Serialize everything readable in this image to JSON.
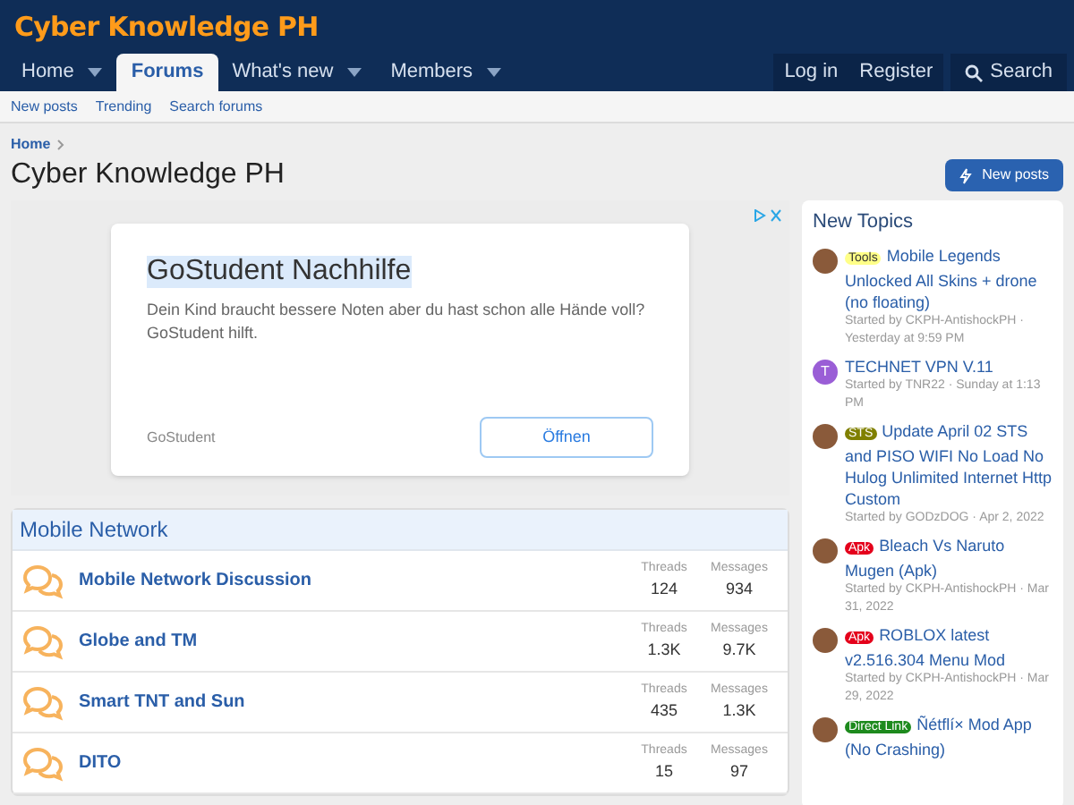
{
  "site": {
    "logo": "Cyber Knowledge PH"
  },
  "nav": {
    "tabs": [
      {
        "label": "Home",
        "selected": false,
        "has_menu": true
      },
      {
        "label": "Forums",
        "selected": true,
        "has_menu": false
      },
      {
        "label": "What's new",
        "selected": false,
        "has_menu": true
      },
      {
        "label": "Members",
        "selected": false,
        "has_menu": true
      }
    ],
    "account": [
      "Log in",
      "Register"
    ],
    "search": "Search"
  },
  "subnav": [
    "New posts",
    "Trending",
    "Search forums"
  ],
  "breadcrumb": [
    "Home"
  ],
  "page_title": "Cyber Knowledge PH",
  "new_posts_button": "New posts",
  "ad": {
    "title": "GoStudent Nachhilfe",
    "text": "Dein Kind braucht bessere Noten aber du hast schon alle Hände voll? GoStudent hilft.",
    "advertiser": "GoStudent",
    "button": "Öffnen"
  },
  "category": {
    "title": "Mobile Network",
    "forums": [
      {
        "name": "Mobile Network Discussion",
        "threads_label": "Threads",
        "threads": "124",
        "messages_label": "Messages",
        "messages": "934"
      },
      {
        "name": "Globe and TM",
        "threads_label": "Threads",
        "threads": "1.3K",
        "messages_label": "Messages",
        "messages": "9.7K"
      },
      {
        "name": "Smart TNT and Sun",
        "threads_label": "Threads",
        "threads": "435",
        "messages_label": "Messages",
        "messages": "1.3K"
      },
      {
        "name": "DITO",
        "threads_label": "Threads",
        "threads": "15",
        "messages_label": "Messages",
        "messages": "97"
      }
    ]
  },
  "sidebar": {
    "title": "New Topics",
    "topics": [
      {
        "avatar": {
          "kind": "photo"
        },
        "tag": {
          "label": "Tools",
          "color": "#ffff88"
        },
        "title": "Mobile Legends Unlocked All Skins + drone (no floating)",
        "meta": "Started by CKPH-AntishockPH · Yesterday at 9:59 PM"
      },
      {
        "avatar": {
          "kind": "letter",
          "letter": "T",
          "color": "#9a5ed6"
        },
        "title": "TECHNET VPN V.11",
        "meta": "Started by TNR22 · Sunday at 1:13 PM"
      },
      {
        "avatar": {
          "kind": "photo"
        },
        "tag": {
          "label": "STS",
          "color": "#808000"
        },
        "title": "Update April 02 STS and PISO WIFI No Load No Hulog Unlimited Internet Http Custom",
        "meta": "Started by GODzDOG · Apr 2, 2022"
      },
      {
        "avatar": {
          "kind": "photo"
        },
        "tag": {
          "label": "Apk",
          "color": "#e4001b"
        },
        "title": "Bleach Vs Naruto Mugen (Apk)",
        "meta": "Started by CKPH-AntishockPH · Mar 31, 2022"
      },
      {
        "avatar": {
          "kind": "photo"
        },
        "tag": {
          "label": "Apk",
          "color": "#e4001b"
        },
        "title": "ROBLOX latest v2.516.304 Menu Mod",
        "meta": "Started by CKPH-AntishockPH · Mar 29, 2022"
      },
      {
        "avatar": {
          "kind": "photo"
        },
        "tag": {
          "label": "Direct Link",
          "color": "#1d8a1d"
        },
        "title": "Ñétflí× Mod App (No Crashing)"
      }
    ]
  }
}
